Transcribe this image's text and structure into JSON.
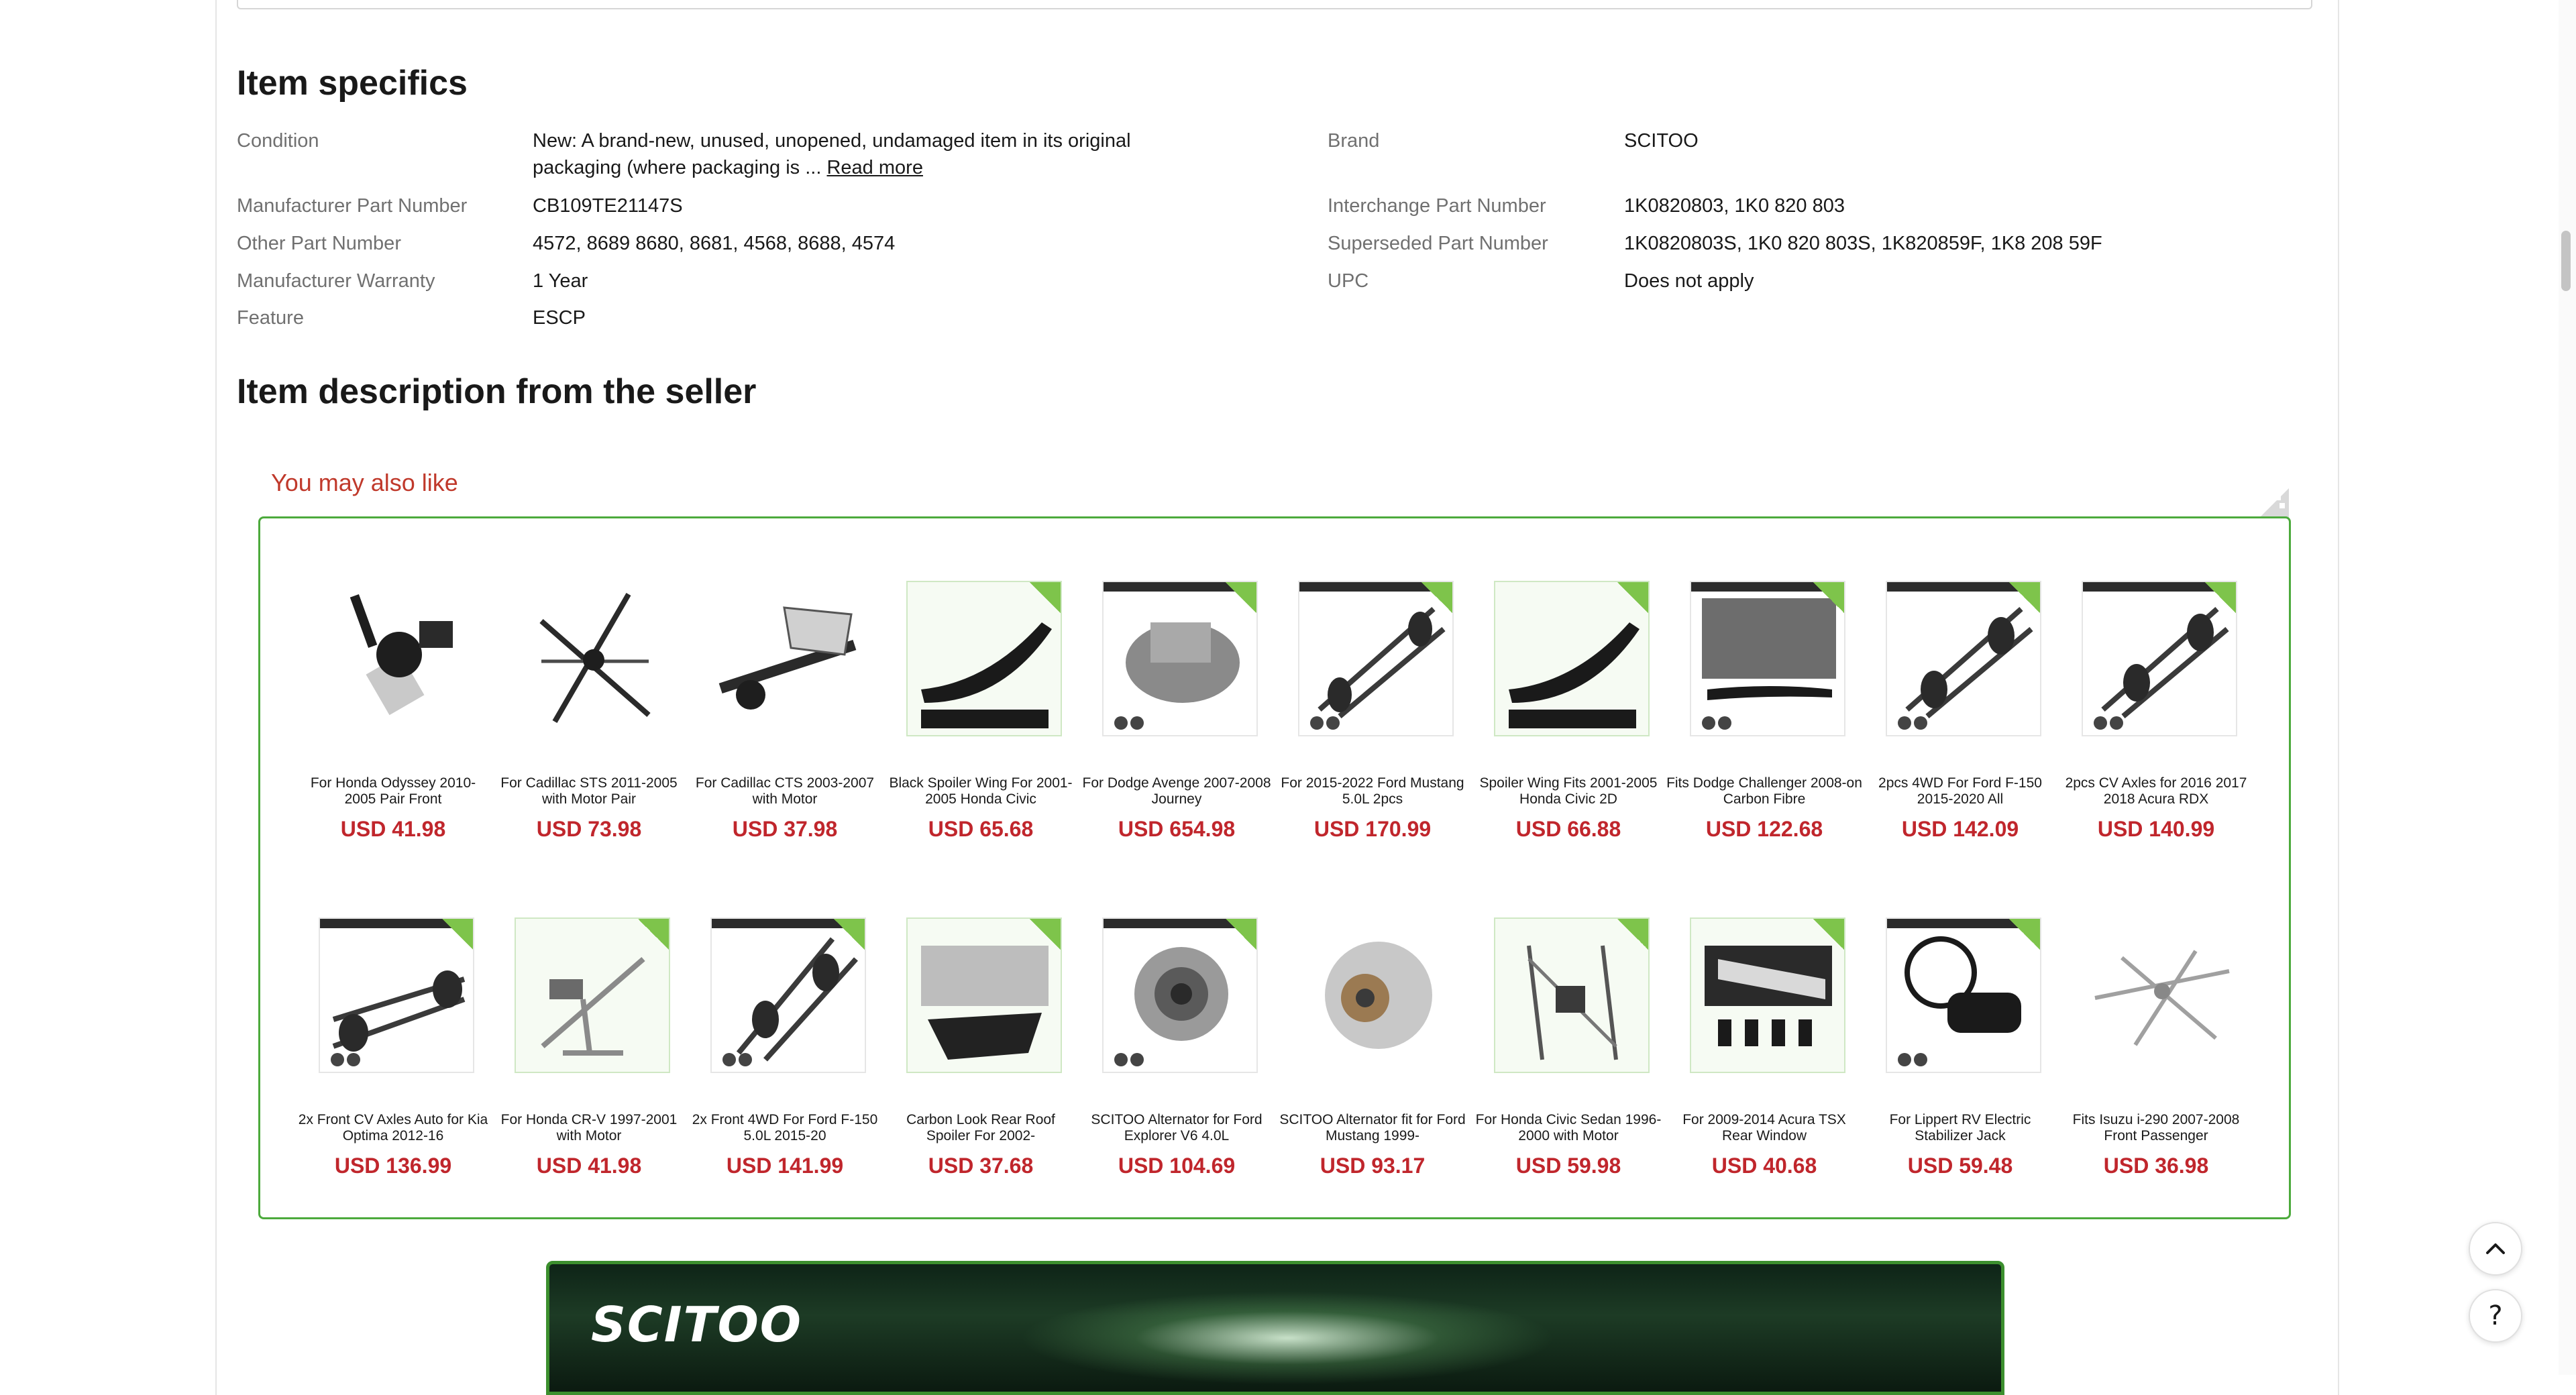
{
  "item_specifics": {
    "title": "Item specifics",
    "left": [
      {
        "label": "Condition",
        "value_line1": "New: A brand-new, unused, unopened, undamaged item in its original",
        "value_line2": "packaging (where packaging is ... ",
        "read_more": "Read more"
      },
      {
        "label": "Manufacturer Part Number",
        "value": "CB109TE21147S"
      },
      {
        "label": "Other Part Number",
        "value": "4572, 8689 8680, 8681, 4568, 8688, 4574"
      },
      {
        "label": "Manufacturer Warranty",
        "value": "1 Year"
      },
      {
        "label": "Feature",
        "value": "ESCP"
      }
    ],
    "right": [
      {
        "label": "Brand",
        "value": "SCITOO"
      },
      {
        "label": "Interchange Part Number",
        "value": "1K0820803, 1K0 820 803"
      },
      {
        "label": "Superseded Part Number",
        "value": "1K0820803S, 1K0 820 803S, 1K820859F, 1K8 208 59F"
      },
      {
        "label": "UPC",
        "value": "Does not apply"
      }
    ]
  },
  "description": {
    "title": "Item description from the seller"
  },
  "recommendations": {
    "title": "You may also like",
    "row1": [
      {
        "name": "For Honda Odyssey 2010-2005 Pair Front",
        "price": "USD 41.98"
      },
      {
        "name": "For Cadillac STS 2011-2005 with Motor Pair",
        "price": "USD 73.98"
      },
      {
        "name": "For Cadillac CTS 2003-2007 with Motor",
        "price": "USD 37.98"
      },
      {
        "name": "Black Spoiler Wing For 2001-2005 Honda Civic",
        "price": "USD 65.68"
      },
      {
        "name": "For Dodge Avenge 2007-2008 Journey",
        "price": "USD 654.98"
      },
      {
        "name": "For 2015-2022 Ford Mustang 5.0L 2pcs",
        "price": "USD 170.99"
      },
      {
        "name": "Spoiler Wing Fits 2001-2005 Honda Civic 2D",
        "price": "USD 66.88"
      },
      {
        "name": "Fits Dodge Challenger 2008-on Carbon Fibre",
        "price": "USD 122.68"
      },
      {
        "name": "2pcs 4WD For Ford F-150 2015-2020 All",
        "price": "USD 142.09"
      },
      {
        "name": "2pcs CV Axles for 2016 2017 2018 Acura RDX",
        "price": "USD 140.99"
      }
    ],
    "row2": [
      {
        "name": "2x Front CV Axles Auto for Kia Optima 2012-16",
        "price": "USD 136.99"
      },
      {
        "name": "For Honda CR-V 1997-2001 with Motor",
        "price": "USD 41.98"
      },
      {
        "name": "2x Front 4WD For Ford F-150 5.0L 2015-20",
        "price": "USD 141.99"
      },
      {
        "name": "Carbon Look Rear Roof Spoiler For 2002-",
        "price": "USD 37.68"
      },
      {
        "name": "SCITOO Alternator for Ford Explorer V6 4.0L",
        "price": "USD 104.69"
      },
      {
        "name": "SCITOO Alternator fit for Ford Mustang 1999-",
        "price": "USD 93.17"
      },
      {
        "name": "For Honda Civic Sedan 1996-2000 with Motor",
        "price": "USD 59.98"
      },
      {
        "name": "For 2009-2014 Acura TSX Rear Window",
        "price": "USD 40.68"
      },
      {
        "name": "For Lippert RV Electric Stabilizer Jack",
        "price": "USD 59.48"
      },
      {
        "name": "Fits Isuzu i-290 2007-2008 Front Passenger",
        "price": "USD 36.98"
      }
    ]
  },
  "banner": {
    "logo": "SCITOO"
  },
  "floating": {
    "up_icon": "chevron-up-icon",
    "help_label": "?"
  },
  "colors": {
    "accent_price": "#c0262c",
    "rec_border": "#4caa3c",
    "rec_title": "#c0392b"
  }
}
